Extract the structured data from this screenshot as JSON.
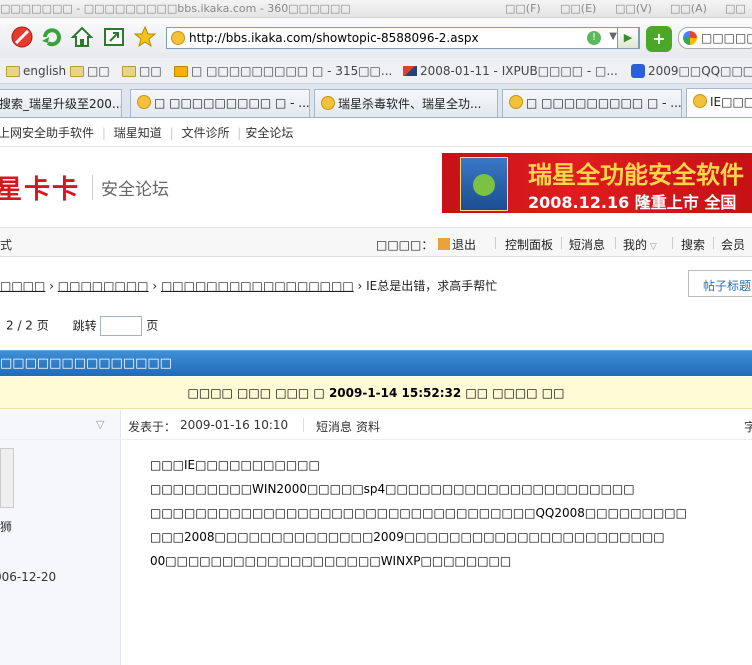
{
  "browser": {
    "title": "□□□□□□□ - □□□□□□□□□bbs.ikaka.com - 360□□□□□□",
    "menus": [
      "□□(F)",
      "□□(E)",
      "□□(V)",
      "□□(A)",
      "□□"
    ],
    "url": "http://bbs.ikaka.com/showtopic-8588096-2.aspx",
    "search_placeholder": "□□□□□",
    "favorites": [
      {
        "label": "english",
        "icon": "folder-icon"
      },
      {
        "label": "□□",
        "icon": "folder-icon"
      },
      {
        "label": "□□",
        "icon": "folder-icon"
      },
      {
        "label": "□ □□□□□□□□□ □ - 315□□...",
        "icon": "site-icon"
      },
      {
        "label": "2008-01-11 - IXPUB□□□□ - □...",
        "icon": "ixpub-icon"
      },
      {
        "label": "2009□□QQ□□□",
        "icon": "paw-icon"
      }
    ],
    "tabs": [
      {
        "label": "搜索_瑞星升级至200..."
      },
      {
        "label": "□ □□□□□□□□□ □ - ..."
      },
      {
        "label": "瑞星杀毒软件、瑞星全功..."
      },
      {
        "label": "□ □□□□□□□□□ □ - ..."
      },
      {
        "label": "IE□□□□"
      }
    ]
  },
  "site": {
    "toplinks": [
      "上网安全助手软件",
      "瑞星知道",
      "文件诊所",
      "安全论坛"
    ],
    "logo": "星卡卡",
    "logo_sub": "安全论坛",
    "banner_title": "瑞星全功能安全软件",
    "banner_sub": "2008.12.16  隆重上市  全国",
    "menu_left": "式",
    "menu_items": {
      "user": "□□□□：",
      "logout": "退出",
      "control": "控制面板",
      "sms": "短消息",
      "mine": "我的",
      "search": "搜索",
      "member": "会员"
    },
    "crumbs": [
      "□□□□",
      "□□□□□□□□",
      "□□□□□□□□□□□□□□□□□",
      "IE总是出错，求高手帮忙"
    ],
    "thread_btn": "帖子标题",
    "pager": {
      "text": "2 / 2 页",
      "jump": "跳转",
      "page": "页"
    },
    "bluebar": "□□□□□□□□□□□□□□",
    "notice": "□□□□ □□□ □□□ □ 2009-1-14 15:52:32 □□ □□□□ □□"
  },
  "post": {
    "posted_at_label": "发表于：",
    "posted_at": "2009-01-16 10:10",
    "sms": "短消息",
    "profile": "资料",
    "right_tag": "字",
    "author_tail": "狮",
    "reg_date": "006-12-20",
    "lines": [
      "□□□IE□□□□□□□□□□□",
      "□□□□□□□□□WIN2000□□□□□sp4□□□□□□□□□□□□□□□□□□□□□□",
      "□□□□□□□□□□□□□□□□□□□□□□□□□□□□□□□□□□QQ2008□□□□□□□□□",
      "□□□2008□□□□□□□□□□□□□□2009□□□□□□□□□□□□□□□□□□□□□□□",
      "00□□□□□□□□□□□□□□□□□□□WINXP□□□□□□□□"
    ]
  }
}
